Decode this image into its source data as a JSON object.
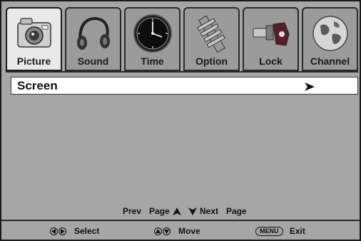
{
  "tabs": [
    {
      "label": "Picture",
      "icon": "camera-icon",
      "active": true
    },
    {
      "label": "Sound",
      "icon": "headphones-icon",
      "active": false
    },
    {
      "label": "Time",
      "icon": "clock-icon",
      "active": false
    },
    {
      "label": "Option",
      "icon": "gear-icon",
      "active": false
    },
    {
      "label": "Lock",
      "icon": "lock-icon",
      "active": false
    },
    {
      "label": "Channel",
      "icon": "globe-icon",
      "active": false
    }
  ],
  "content": {
    "rows": [
      {
        "label": "Screen",
        "icon": "submenu-arrow-icon"
      }
    ]
  },
  "paging": {
    "prev": "Prev",
    "page1": "Page",
    "next": "Next",
    "page2": "Page"
  },
  "help": {
    "select": {
      "key_icon": "left-right-keys-icon",
      "label": "Select"
    },
    "move": {
      "key_icon": "up-down-keys-icon",
      "label": "Move"
    },
    "exit": {
      "key": "MENU",
      "label": "Exit"
    }
  },
  "colors": {
    "background": "#a6a6a6",
    "active_tab": "#e9e9e9",
    "inactive_tab": "#9b9b9b",
    "selected_row": "#ffffff"
  }
}
